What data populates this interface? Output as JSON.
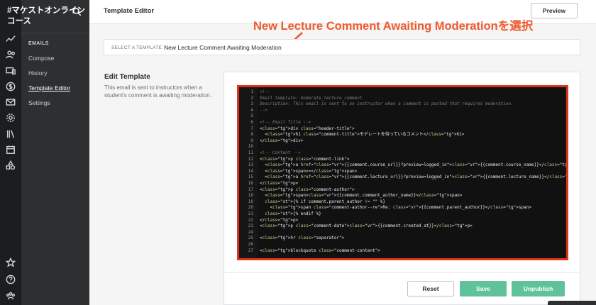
{
  "app": {
    "brand": "#マケストオンライン\nコース"
  },
  "nav": {
    "section_heading": "EMAILS",
    "items": [
      {
        "label": "Compose"
      },
      {
        "label": "History"
      },
      {
        "label": "Template Editor"
      },
      {
        "label": "Settings"
      }
    ]
  },
  "rail_icons": [
    "trend-icon",
    "users-icon",
    "devices-icon",
    "dollar-icon",
    "mail-icon",
    "gear-icon",
    "library-icon",
    "calendar-icon",
    "shapes-icon",
    "star-icon",
    "help-icon",
    "team-icon"
  ],
  "topbar": {
    "title": "Template Editor",
    "preview_label": "Preview"
  },
  "annotation": {
    "text": "New Lecture Comment Awaiting Moderationを選択",
    "color": "#ef5a2e"
  },
  "template_select": {
    "label": "SELECT A TEMPLATE",
    "value": "New Lecture Comment Awaiting Moderation"
  },
  "edit_template": {
    "title": "Edit Template",
    "description": "This email is sent to instructors when a student's comment is awaiting moderation."
  },
  "code_lines": [
    "<!--",
    "Email template: moderate_lecture_comment",
    "Description: This email is sent to an instructor when a comment is posted that requires moderation.",
    "-->",
    "",
    "<!-- Email Title -->",
    "<div class=\"header-title\">",
    "  <h1 class=\"comment-title\">モデレートを待っているコメント</h1>",
    "</div>",
    "",
    "<!-- Content -->",
    "<p class=\"comment-link\">",
    "  <a href=\"{{comment.course_url}}?preview=logged_in\">{{comment.course_name}}</a>",
    "  <span>></span>",
    "  <a href=\"{{comment.lecture_url}}?preview=logged_in\">{{comment.lecture_name}}</a>",
    "</p>",
    "<p class=\"comment-author\">",
    "  <span>{{comment.comment_author_name}}</span>",
    "  {% if comment.parent_author != \"\" %}",
    "    <span class=\"comment-author--re\">Re: {{comment.parent_author}}</span>",
    "  {% endif %}",
    "</p>",
    "<p class=\"comment-date\">{{comment.created_at}}</p>",
    "",
    "<hr class=\"separator\">",
    "",
    "<blockquote class=\"comment-content\">"
  ],
  "buttons": {
    "reset": "Reset",
    "save": "Save",
    "unpublish": "Unpublish"
  },
  "colors": {
    "accent_green": "#5fc29a",
    "highlight_red": "#e0331c",
    "sidebar_dark": "#2d2f31"
  }
}
